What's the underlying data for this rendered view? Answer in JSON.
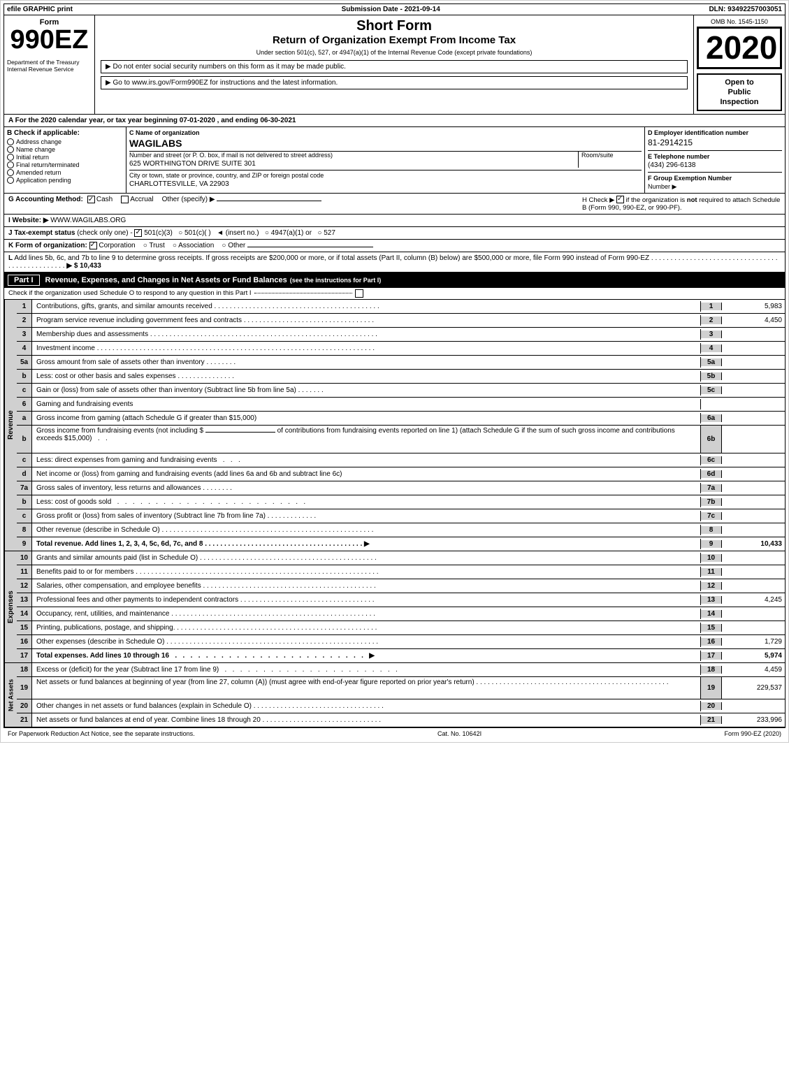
{
  "header": {
    "efile": "efile GRAPHIC print",
    "submission": "Submission Date - 2021-09-14",
    "dln": "DLN: 93492257003051"
  },
  "form": {
    "number": "990EZ",
    "short_form": "Short Form",
    "title": "Return of Organization Exempt From Income Tax",
    "under_section": "Under section 501(c), 527, or 4947(a)(1) of the Internal Revenue Code (except private foundations)",
    "ssn_note": "▶ Do not enter social security numbers on this form as it may be made public.",
    "irs_link": "▶ Go to www.irs.gov/Form990EZ for instructions and the latest information.",
    "omb": "OMB No. 1545-1150",
    "year": "2020",
    "open_to_public": "Open to Public Inspection",
    "dept": "Department of the Treasury Internal Revenue Service"
  },
  "tax_year_row": {
    "text": "A  For the 2020 calendar year, or tax year beginning 07-01-2020 , and ending 06-30-2021"
  },
  "section_b": {
    "label": "B  Check if applicable:",
    "items": [
      "Address change",
      "Name change",
      "Initial return",
      "Final return/terminated",
      "Amended return",
      "Application pending"
    ]
  },
  "section_c": {
    "label": "C Name of organization",
    "value": "WAGILABS",
    "street_label": "Number and street (or P. O. box, if mail is not delivered to street address)",
    "street_value": "625 WORTHINGTON DRIVE SUITE 301",
    "room_label": "Room/suite",
    "city_label": "City or town, state or province, country, and ZIP or foreign postal code",
    "city_value": "CHARLOTTESVILLE, VA  22903"
  },
  "section_d": {
    "label": "D Employer identification number",
    "value": "81-2914215"
  },
  "section_e": {
    "label": "E Telephone number",
    "value": "(434) 296-6138"
  },
  "section_f": {
    "label": "F Group Exemption Number",
    "arrow": "▶"
  },
  "section_g": {
    "label": "G Accounting Method:",
    "cash": "✓ Cash",
    "accrual": "Accrual",
    "other": "Other (specify) ▶",
    "cash_checked": true
  },
  "section_h": {
    "text": "H  Check ▶ ☑ if the organization is not required to attach Schedule B (Form 990, 990-EZ, or 990-PF)."
  },
  "section_i": {
    "label": "I Website: ▶",
    "value": "WWW.WAGILABS.ORG"
  },
  "section_j": {
    "label": "J Tax-exempt status",
    "text": "(check only one) - ☑ 501(c)(3)  ○ 501(c)(   )  ◄ (insert no.)  ○ 4947(a)(1) or  ○ 527"
  },
  "section_k": {
    "label": "K Form of organization:",
    "corp": "☑ Corporation",
    "trust": "Trust",
    "assoc": "Association",
    "other": "Other"
  },
  "section_l": {
    "text": "L  Add lines 5b, 6c, and 7b to line 9 to determine gross receipts. If gross receipts are $200,000 or more, or if total assets (Part II, column (B) below) are $500,000 or more, file Form 990 instead of Form 990-EZ",
    "amount": "▶ $ 10,433"
  },
  "part1": {
    "label": "Part I",
    "title": "Revenue, Expenses, and Changes in Net Assets or Fund Balances",
    "subtitle": "(see the instructions for Part I)",
    "check_text": "Check if the organization used Schedule O to respond to any question in this Part I",
    "lines": [
      {
        "num": "1",
        "desc": "Contributions, gifts, grants, and similar amounts received",
        "ref": "1",
        "amount": "5,983"
      },
      {
        "num": "2",
        "desc": "Program service revenue including government fees and contracts",
        "ref": "2",
        "amount": "4,450"
      },
      {
        "num": "3",
        "desc": "Membership dues and assessments",
        "ref": "3",
        "amount": ""
      },
      {
        "num": "4",
        "desc": "Investment income",
        "ref": "4",
        "amount": ""
      },
      {
        "num": "5a",
        "desc": "Gross amount from sale of assets other than inventory",
        "ref": "5a",
        "amount": ""
      },
      {
        "num": "b",
        "desc": "Less: cost or other basis and sales expenses",
        "ref": "5b",
        "amount": ""
      },
      {
        "num": "c",
        "desc": "Gain or (loss) from sale of assets other than inventory (Subtract line 5b from line 5a)",
        "ref": "5c",
        "amount": ""
      },
      {
        "num": "6",
        "desc": "Gaming and fundraising events",
        "ref": "",
        "amount": ""
      },
      {
        "num": "a",
        "desc": "Gross income from gaming (attach Schedule G if greater than $15,000)",
        "ref": "6a",
        "amount": ""
      },
      {
        "num": "b",
        "desc": "Gross income from fundraising events (not including $  of contributions from fundraising events reported on line 1) (attach Schedule G if the sum of such gross income and contributions exceeds $15,000)",
        "ref": "6b",
        "amount": ""
      },
      {
        "num": "c",
        "desc": "Less: direct expenses from gaming and fundraising events",
        "ref": "6c",
        "amount": ""
      },
      {
        "num": "d",
        "desc": "Net income or (loss) from gaming and fundraising events (add lines 6a and 6b and subtract line 6c)",
        "ref": "6d",
        "amount": ""
      },
      {
        "num": "7a",
        "desc": "Gross sales of inventory, less returns and allowances",
        "ref": "7a",
        "amount": ""
      },
      {
        "num": "b",
        "desc": "Less: cost of goods sold",
        "ref": "7b",
        "amount": ""
      },
      {
        "num": "c",
        "desc": "Gross profit or (loss) from sales of inventory (Subtract line 7b from line 7a)",
        "ref": "7c",
        "amount": ""
      },
      {
        "num": "8",
        "desc": "Other revenue (describe in Schedule O)",
        "ref": "8",
        "amount": ""
      },
      {
        "num": "9",
        "desc": "Total revenue. Add lines 1, 2, 3, 4, 5c, 6d, 7c, and 8",
        "ref": "9",
        "amount": "10,433",
        "bold": true,
        "arrow": true
      }
    ]
  },
  "expenses": {
    "label": "Expenses",
    "lines": [
      {
        "num": "10",
        "desc": "Grants and similar amounts paid (list in Schedule O)",
        "ref": "10",
        "amount": ""
      },
      {
        "num": "11",
        "desc": "Benefits paid to or for members",
        "ref": "11",
        "amount": ""
      },
      {
        "num": "12",
        "desc": "Salaries, other compensation, and employee benefits",
        "ref": "12",
        "amount": ""
      },
      {
        "num": "13",
        "desc": "Professional fees and other payments to independent contractors",
        "ref": "13",
        "amount": "4,245"
      },
      {
        "num": "14",
        "desc": "Occupancy, rent, utilities, and maintenance",
        "ref": "14",
        "amount": ""
      },
      {
        "num": "15",
        "desc": "Printing, publications, postage, and shipping.",
        "ref": "15",
        "amount": ""
      },
      {
        "num": "16",
        "desc": "Other expenses (describe in Schedule O)",
        "ref": "16",
        "amount": "1,729"
      },
      {
        "num": "17",
        "desc": "Total expenses. Add lines 10 through 16",
        "ref": "17",
        "amount": "5,974",
        "bold": true,
        "arrow": true
      }
    ]
  },
  "netassets": {
    "label": "Net Assets",
    "lines": [
      {
        "num": "18",
        "desc": "Excess or (deficit) for the year (Subtract line 17 from line 9)",
        "ref": "18",
        "amount": "4,459"
      },
      {
        "num": "19",
        "desc": "Net assets or fund balances at beginning of year (from line 27, column (A)) (must agree with end-of-year figure reported on prior year's return)",
        "ref": "19",
        "amount": "229,537"
      },
      {
        "num": "20",
        "desc": "Other changes in net assets or fund balances (explain in Schedule O)",
        "ref": "20",
        "amount": ""
      },
      {
        "num": "21",
        "desc": "Net assets or fund balances at end of year. Combine lines 18 through 20",
        "ref": "21",
        "amount": "233,996"
      }
    ]
  },
  "footer": {
    "paperwork": "For Paperwork Reduction Act Notice, see the separate instructions.",
    "cat_no": "Cat. No. 10642I",
    "form_footer": "Form 990-EZ (2020)"
  }
}
